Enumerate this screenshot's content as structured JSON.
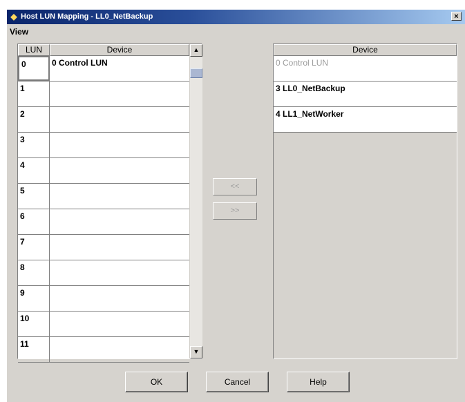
{
  "window": {
    "title": "Host LUN Mapping - LL0_NetBackup",
    "close_label": "×"
  },
  "menubar": {
    "view": "View"
  },
  "left_table": {
    "headers": {
      "lun": "LUN",
      "device": "Device"
    },
    "rows": [
      {
        "lun": "0",
        "device": "0 Control LUN"
      },
      {
        "lun": "1",
        "device": ""
      },
      {
        "lun": "2",
        "device": ""
      },
      {
        "lun": "3",
        "device": ""
      },
      {
        "lun": "4",
        "device": ""
      },
      {
        "lun": "5",
        "device": ""
      },
      {
        "lun": "6",
        "device": ""
      },
      {
        "lun": "7",
        "device": ""
      },
      {
        "lun": "8",
        "device": ""
      },
      {
        "lun": "9",
        "device": ""
      },
      {
        "lun": "10",
        "device": ""
      },
      {
        "lun": "11",
        "device": ""
      }
    ]
  },
  "middle_buttons": {
    "move_left": "<<",
    "move_right": ">>"
  },
  "right_table": {
    "header": "Device",
    "rows": [
      {
        "device": "0 Control LUN",
        "disabled": true
      },
      {
        "device": "3 LL0_NetBackup",
        "disabled": false
      },
      {
        "device": "4 LL1_NetWorker",
        "disabled": false
      }
    ]
  },
  "footer": {
    "ok": "OK",
    "cancel": "Cancel",
    "help": "Help"
  },
  "colors": {
    "title_gradient_start": "#0a246a",
    "title_gradient_end": "#a6caf0",
    "dialog_bg": "#d6d3ce"
  }
}
